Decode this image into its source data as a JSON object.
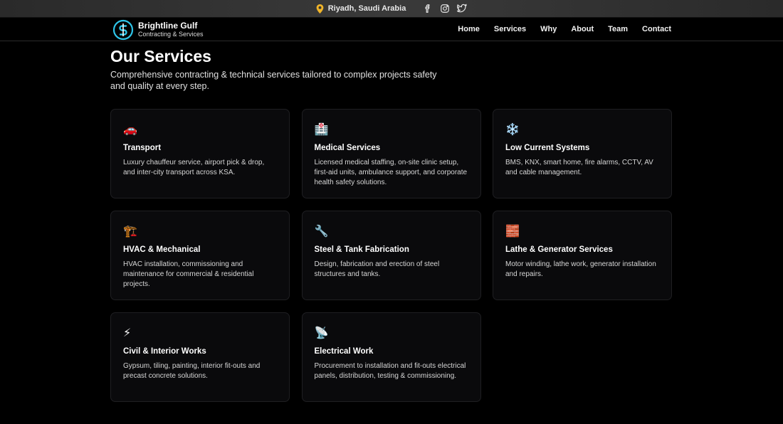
{
  "topbar": {
    "location": "Riyadh, Saudi Arabia",
    "social_icons": [
      "facebook-icon",
      "instagram-icon",
      "twitter-icon"
    ]
  },
  "brand": {
    "name": "Brightline Gulf",
    "tagline": "Contracting & Services",
    "accent": "#2ec4e8"
  },
  "nav": {
    "items": [
      "Home",
      "Services",
      "Why",
      "About",
      "Team",
      "Contact"
    ]
  },
  "services": {
    "title": "Our Services",
    "subtitle": "Comprehensive contracting & technical services tailored to complex projects safety and quality at every step.",
    "cards": [
      {
        "icon": "car-icon",
        "glyph": "🚗",
        "title": "Transport",
        "desc": "Luxury chauffeur service, airport pick & drop, and inter-city transport across KSA."
      },
      {
        "icon": "hospital-icon",
        "glyph": "🏥",
        "title": "Medical Services",
        "desc": "Licensed medical staffing, on-site clinic setup, first-aid units, ambulance support, and corporate health safety solutions."
      },
      {
        "icon": "snowflake-icon",
        "glyph": "❄️",
        "title": "Low Current Systems",
        "desc": "BMS, KNX, smart home, fire alarms, CCTV, AV and cable management."
      },
      {
        "icon": "crane-icon",
        "glyph": "🏗️",
        "title": "HVAC & Mechanical",
        "desc": "HVAC installation, commissioning and maintenance for commercial & residential projects."
      },
      {
        "icon": "wrench-icon",
        "glyph": "🔧",
        "title": "Steel & Tank Fabrication",
        "desc": "Design, fabrication and erection of steel structures and tanks."
      },
      {
        "icon": "brick-icon",
        "glyph": "🧱",
        "title": "Lathe & Generator Services",
        "desc": "Motor winding, lathe work, generator installation and repairs."
      },
      {
        "icon": "lightning-icon",
        "glyph": "⚡",
        "title": "Civil & Interior Works",
        "desc": "Gypsum, tiling, painting, interior fit-outs and precast concrete solutions."
      },
      {
        "icon": "satellite-dish-icon",
        "glyph": "📡",
        "title": "Electrical Work",
        "desc": "Procurement to installation and fit-outs electrical panels, distribution, testing & commissioning."
      }
    ]
  }
}
